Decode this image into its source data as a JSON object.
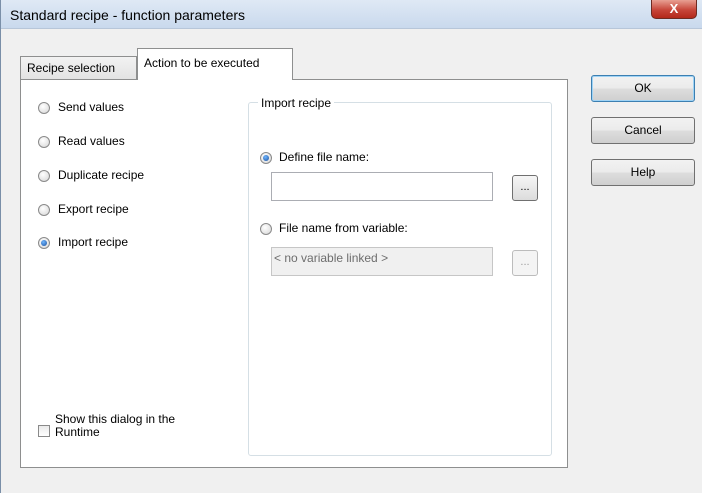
{
  "window": {
    "title": "Standard recipe - function parameters",
    "close_glyph": "X"
  },
  "tabs": [
    {
      "label": "Recipe selection",
      "active": false
    },
    {
      "label": "Action to be executed",
      "active": true
    }
  ],
  "actions": [
    {
      "label": "Send values",
      "checked": false
    },
    {
      "label": "Read values",
      "checked": false
    },
    {
      "label": "Duplicate recipe",
      "checked": false
    },
    {
      "label": "Export recipe",
      "checked": false
    },
    {
      "label": "Import recipe",
      "checked": true
    }
  ],
  "import_group": {
    "title": "Import recipe",
    "define_file_name": {
      "label": "Define file name:",
      "checked": true,
      "value": "",
      "browse_label": "..."
    },
    "file_from_variable": {
      "label": "File name from variable:",
      "checked": false,
      "value": "< no variable linked >",
      "browse_label": "..."
    }
  },
  "show_in_runtime": {
    "label_line1": "Show this dialog in the",
    "label_line2": "Runtime",
    "checked": false
  },
  "buttons": {
    "ok": "OK",
    "cancel": "Cancel",
    "help": "Help"
  }
}
